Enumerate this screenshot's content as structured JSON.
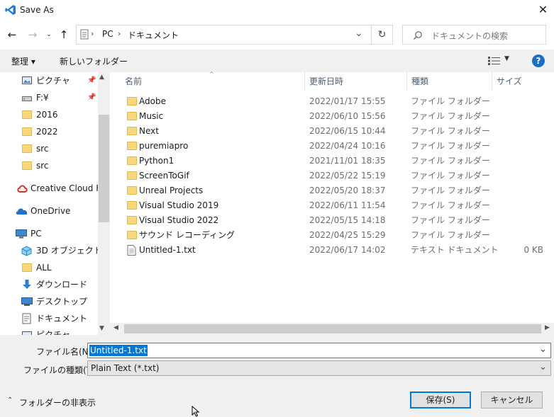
{
  "window": {
    "title": "Save As",
    "close_glyph": "✕"
  },
  "nav": {
    "back_icon": "back-arrow-icon",
    "breadcrumb": [
      "PC",
      "ドキュメント"
    ],
    "search_placeholder": "ドキュメントの検索"
  },
  "toolbar": {
    "organize_label": "整理 ▾",
    "new_folder_label": "新しいフォルダー"
  },
  "sidebar": {
    "items": [
      {
        "label": "ピクチャ",
        "icon": "pictures-icon",
        "pinned": true
      },
      {
        "label": "F:¥",
        "icon": "drive-icon",
        "pinned": true
      },
      {
        "label": "2016",
        "icon": "folder-icon"
      },
      {
        "label": "2022",
        "icon": "folder-icon"
      },
      {
        "label": "src",
        "icon": "folder-icon"
      },
      {
        "label": "src",
        "icon": "folder-icon"
      },
      {
        "label": "Creative Cloud Files",
        "icon": "creative-cloud-icon"
      },
      {
        "label": "OneDrive",
        "icon": "onedrive-icon"
      },
      {
        "label": "PC",
        "icon": "pc-icon"
      },
      {
        "label": "3D オブジェクト",
        "icon": "3d-objects-icon"
      },
      {
        "label": "ALL",
        "icon": "folder-icon"
      },
      {
        "label": "ダウンロード",
        "icon": "download-icon"
      },
      {
        "label": "デスクトップ",
        "icon": "desktop-icon"
      },
      {
        "label": "ドキュメント",
        "icon": "documents-icon"
      },
      {
        "label": "ピクチャ",
        "icon": "pictures-icon"
      }
    ]
  },
  "columns": {
    "name": "名前",
    "date": "更新日時",
    "type": "種類",
    "size": "サイズ"
  },
  "files": [
    {
      "name": "Adobe",
      "date": "2022/01/17 15:55",
      "type": "ファイル フォルダー",
      "size": ""
    },
    {
      "name": "Music",
      "date": "2022/06/10 15:56",
      "type": "ファイル フォルダー",
      "size": ""
    },
    {
      "name": "Next",
      "date": "2022/06/15 10:44",
      "type": "ファイル フォルダー",
      "size": ""
    },
    {
      "name": "puremiapro",
      "date": "2022/04/24 10:16",
      "type": "ファイル フォルダー",
      "size": ""
    },
    {
      "name": "Python1",
      "date": "2021/11/01 18:35",
      "type": "ファイル フォルダー",
      "size": ""
    },
    {
      "name": "ScreenToGif",
      "date": "2022/05/22 15:19",
      "type": "ファイル フォルダー",
      "size": ""
    },
    {
      "name": "Unreal Projects",
      "date": "2022/05/20 18:37",
      "type": "ファイル フォルダー",
      "size": ""
    },
    {
      "name": "Visual Studio 2019",
      "date": "2022/06/11 11:54",
      "type": "ファイル フォルダー",
      "size": ""
    },
    {
      "name": "Visual Studio 2022",
      "date": "2022/05/15 14:18",
      "type": "ファイル フォルダー",
      "size": ""
    },
    {
      "name": "サウンド レコーディング",
      "date": "2022/04/25 15:29",
      "type": "ファイル フォルダー",
      "size": ""
    },
    {
      "name": "Untitled-1.txt",
      "date": "2022/06/17 14:02",
      "type": "テキスト ドキュメント",
      "size": "0 KB"
    }
  ],
  "form": {
    "filename_label": "ファイル名(N):",
    "filename_value": "Untitled-1.txt",
    "filetype_label": "ファイルの種類(T):",
    "filetype_value": "Plain Text (*.txt)"
  },
  "footer": {
    "hide_folders_label": "フォルダーの非表示",
    "save_label": "保存(S)",
    "cancel_label": "キャンセル"
  },
  "colors": {
    "accent": "#0078d7",
    "folder": "#f7d87c"
  }
}
